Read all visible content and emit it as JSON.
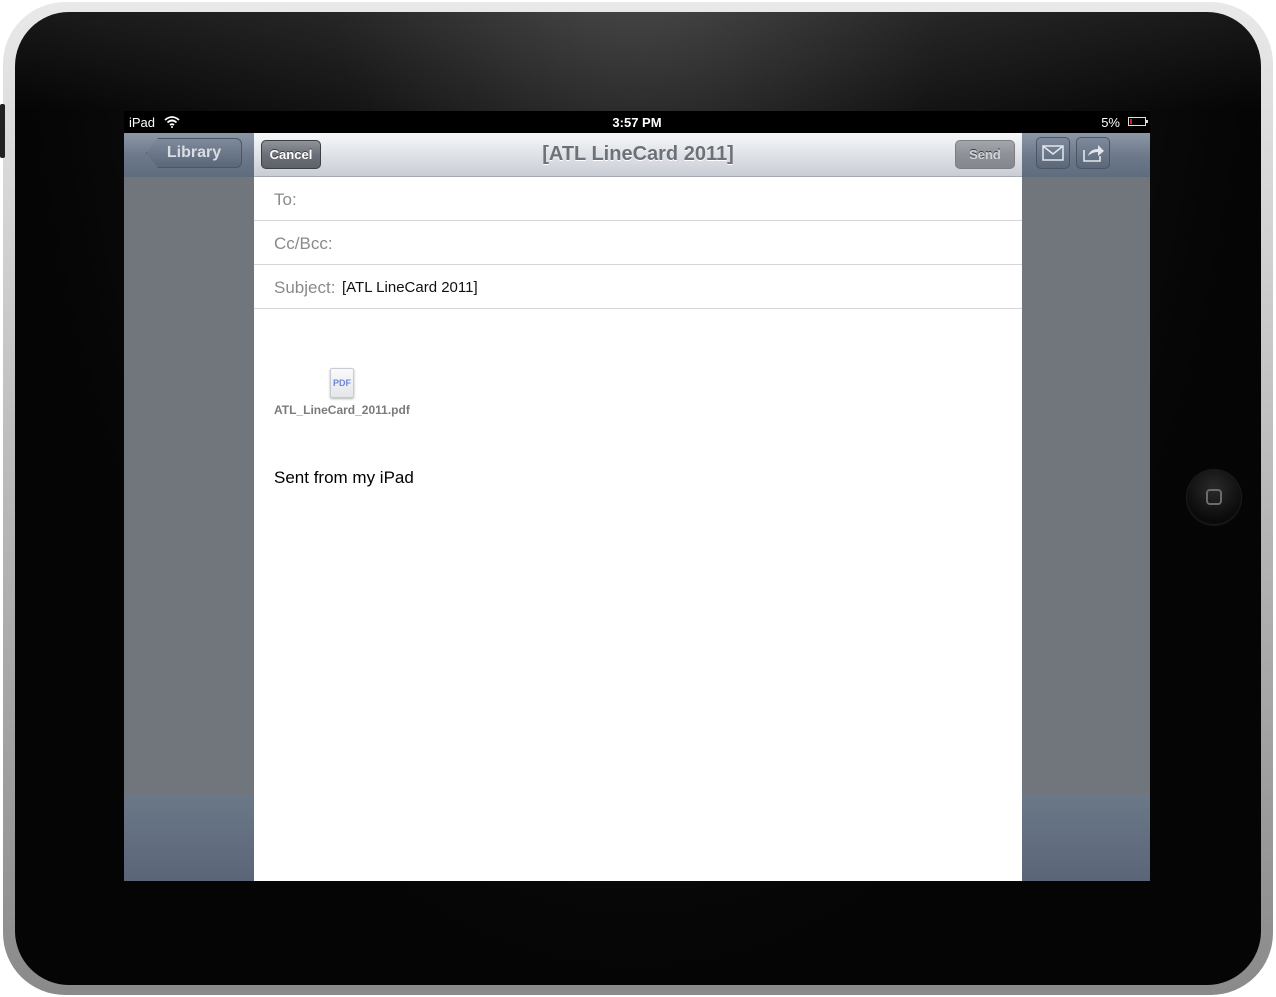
{
  "status_bar": {
    "device": "iPad",
    "time": "3:57 PM",
    "battery": "5%"
  },
  "app_toolbar": {
    "back_label": "Library",
    "icons": [
      "mail-icon",
      "share-icon"
    ]
  },
  "compose": {
    "title": "[ATL LineCard 2011]",
    "cancel_label": "Cancel",
    "send_label": "Send",
    "to_label": "To:",
    "cc_label": "Cc/Bcc:",
    "subject_label": "Subject:",
    "subject_value": "[ATL LineCard 2011]",
    "attachment": {
      "icon_text": "PDF",
      "filename": "ATL_LineCard_2011.pdf"
    },
    "signature": "Sent from my iPad"
  },
  "colors": {
    "battery_low": "#d21c1c",
    "pdf_icon_text": "#6b84d8"
  }
}
